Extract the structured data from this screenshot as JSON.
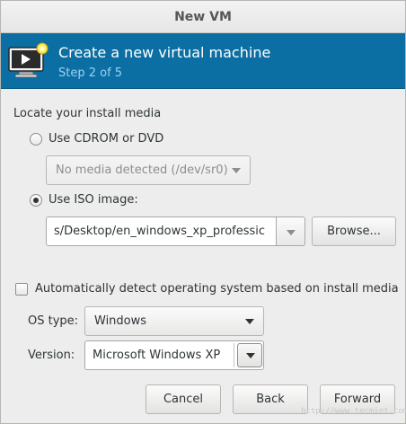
{
  "window": {
    "title": "New VM"
  },
  "banner": {
    "heading": "Create a new virtual machine",
    "step": "Step 2 of 5",
    "icon": "virtual-machine-icon",
    "bg_color": "#0b6fa3"
  },
  "install_media": {
    "label": "Locate your install media",
    "cdrom_option": {
      "label": "Use CDROM or DVD",
      "checked": false
    },
    "cdrom_combo": {
      "value": "No media detected (/dev/sr0)",
      "disabled": true
    },
    "iso_option": {
      "label": "Use ISO image:",
      "checked": true
    },
    "iso_path": {
      "value": "s/Desktop/en_windows_xp_professic"
    },
    "browse_label": "Browse..."
  },
  "os_detection": {
    "auto_detect_label": "Automatically detect operating system based on install media",
    "auto_detect_checked": false,
    "os_type_label": "OS type:",
    "os_type_value": "Windows",
    "version_label": "Version:",
    "version_value": "Microsoft Windows XP"
  },
  "buttons": {
    "cancel": "Cancel",
    "back": "Back",
    "forward": "Forward"
  },
  "watermark": "http://www.tecmint.com"
}
